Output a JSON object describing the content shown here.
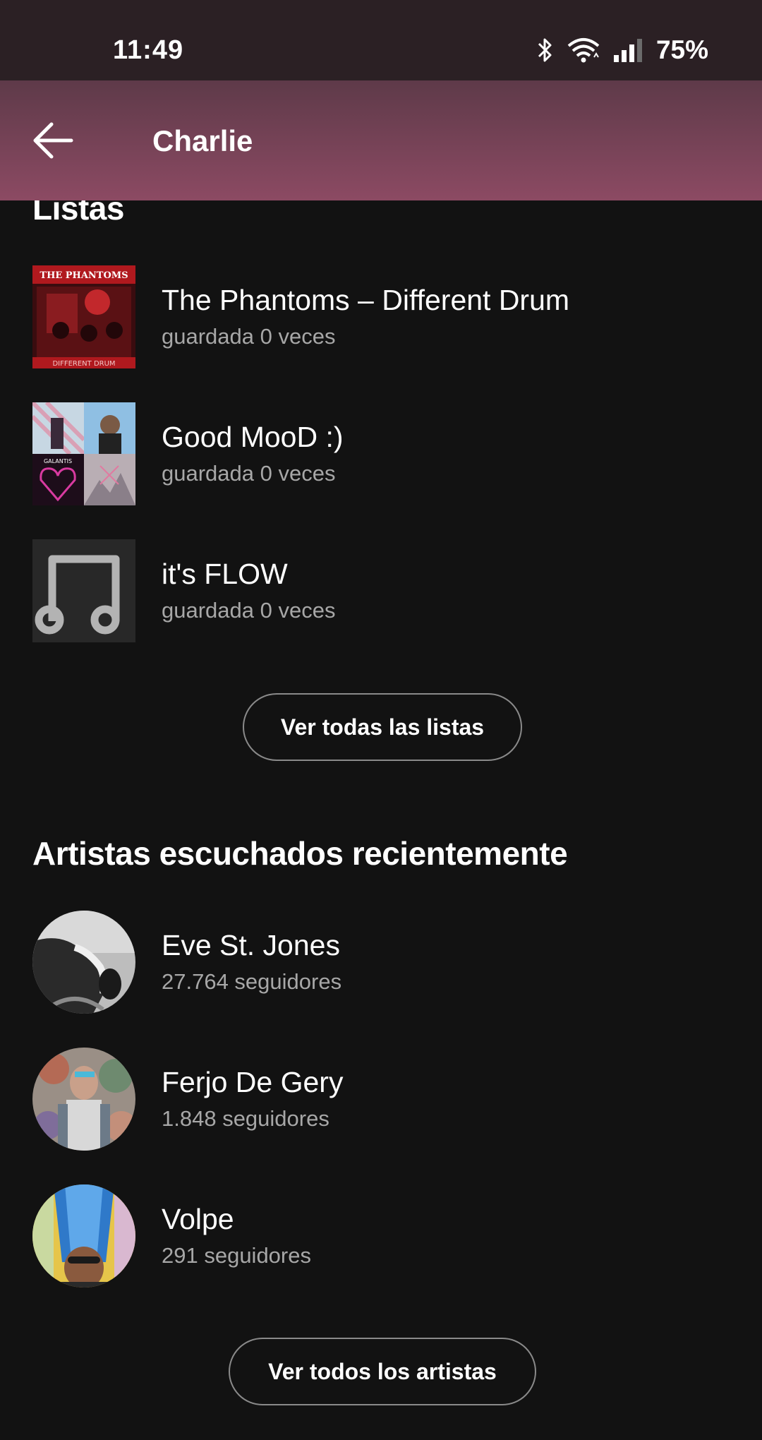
{
  "status_bar": {
    "time": "11:49",
    "battery": "75%",
    "icons": [
      "bluetooth-icon",
      "wifi-icon",
      "signal-icon"
    ]
  },
  "header": {
    "title": "Charlie",
    "back_icon": "arrow-left-icon"
  },
  "playlists": {
    "section_title": "Listas",
    "items": [
      {
        "title": "The Phantoms – Different Drum",
        "subtitle": "guardada 0 veces",
        "cover_text": "THE PHANTOMS",
        "cover_bottom_text": "DIFFERENT DRUM"
      },
      {
        "title": "Good MooD :)",
        "subtitle": "guardada 0 veces",
        "cover_text": "GALANTIS"
      },
      {
        "title": "it's FLOW",
        "subtitle": "guardada 0 veces",
        "cover_icon": "music-note-icon"
      }
    ],
    "see_all_label": "Ver todas las listas"
  },
  "artists": {
    "section_title": "Artistas escuchados recientemente",
    "items": [
      {
        "name": "Eve St. Jones",
        "followers": "27.764 seguidores"
      },
      {
        "name": "Ferjo De Gery",
        "followers": "1.848 seguidores"
      },
      {
        "name": "Volpe",
        "followers": "291 seguidores"
      }
    ],
    "see_all_label": "Ver todos los artistas"
  },
  "colors": {
    "background": "#121212",
    "header_gradient_top": "#5e3a49",
    "header_gradient_bottom": "#8c4a63",
    "secondary_text": "#a7a7a7"
  }
}
